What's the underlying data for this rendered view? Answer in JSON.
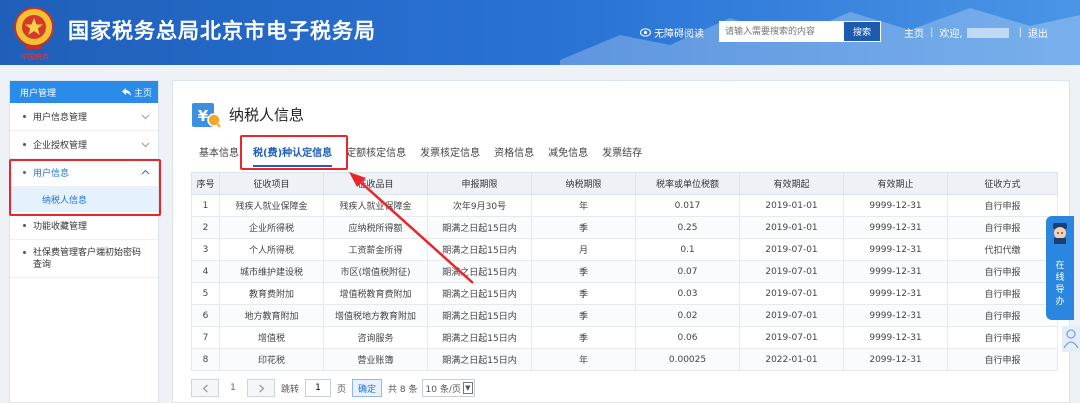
{
  "header": {
    "title": "国家税务总局北京市电子税务局",
    "emblem_caption": "中国税务",
    "accessibility": "无障碍阅读",
    "search_placeholder": "请输入需要搜索的内容",
    "search_button": "搜索",
    "home": "主页",
    "welcome": "欢迎,",
    "logout": "退出"
  },
  "sidebar": {
    "title": "用户管理",
    "home": "主页",
    "items": [
      {
        "label": "用户信息管理"
      },
      {
        "label": "企业授权管理"
      },
      {
        "label": "用户信息"
      },
      {
        "label": "纳税人信息"
      },
      {
        "label": "功能收藏管理"
      },
      {
        "label": "社保费管理客户端初始密码查询"
      }
    ]
  },
  "main": {
    "title": "纳税人信息",
    "tabs": [
      {
        "label": "基本信息"
      },
      {
        "label": "税(费)种认定信息"
      },
      {
        "label": "定额核定信息"
      },
      {
        "label": "发票核定信息"
      },
      {
        "label": "资格信息"
      },
      {
        "label": "减免信息"
      },
      {
        "label": "发票结存"
      }
    ],
    "table": {
      "headers": [
        "序号",
        "征收项目",
        "征收品目",
        "申报期限",
        "纳税期限",
        "税率或单位税额",
        "有效期起",
        "有效期止",
        "征收方式"
      ],
      "rows": [
        [
          "1",
          "残疾人就业保障金",
          "残疾人就业保障金",
          "次年9月30号",
          "年",
          "0.017",
          "2019-01-01",
          "9999-12-31",
          "自行申报"
        ],
        [
          "2",
          "企业所得税",
          "应纳税所得额",
          "期满之日起15日内",
          "季",
          "0.25",
          "2019-01-01",
          "9999-12-31",
          "自行申报"
        ],
        [
          "3",
          "个人所得税",
          "工资薪金所得",
          "期满之日起15日内",
          "月",
          "0.1",
          "2019-07-01",
          "9999-12-31",
          "代扣代缴"
        ],
        [
          "4",
          "城市维护建设税",
          "市区(增值税附征)",
          "期满之日起15日内",
          "季",
          "0.07",
          "2019-07-01",
          "9999-12-31",
          "自行申报"
        ],
        [
          "5",
          "教育费附加",
          "增值税教育费附加",
          "期满之日起15日内",
          "季",
          "0.03",
          "2019-07-01",
          "9999-12-31",
          "自行申报"
        ],
        [
          "6",
          "地方教育附加",
          "增值税地方教育附加",
          "期满之日起15日内",
          "季",
          "0.02",
          "2019-07-01",
          "9999-12-31",
          "自行申报"
        ],
        [
          "7",
          "增值税",
          "咨询服务",
          "期满之日起15日内",
          "季",
          "0.06",
          "2019-07-01",
          "9999-12-31",
          "自行申报"
        ],
        [
          "8",
          "印花税",
          "营业账簿",
          "期满之日起15日内",
          "年",
          "0.00025",
          "2022-01-01",
          "2099-12-31",
          "自行申报"
        ]
      ]
    },
    "pager": {
      "current_page": "1",
      "goto_label": "跳转",
      "goto_value": "1",
      "page_label": "页",
      "confirm": "确定",
      "total": "共 8 条",
      "per_page": "10 条/页"
    }
  },
  "float_guide": {
    "label": "在线导办"
  }
}
